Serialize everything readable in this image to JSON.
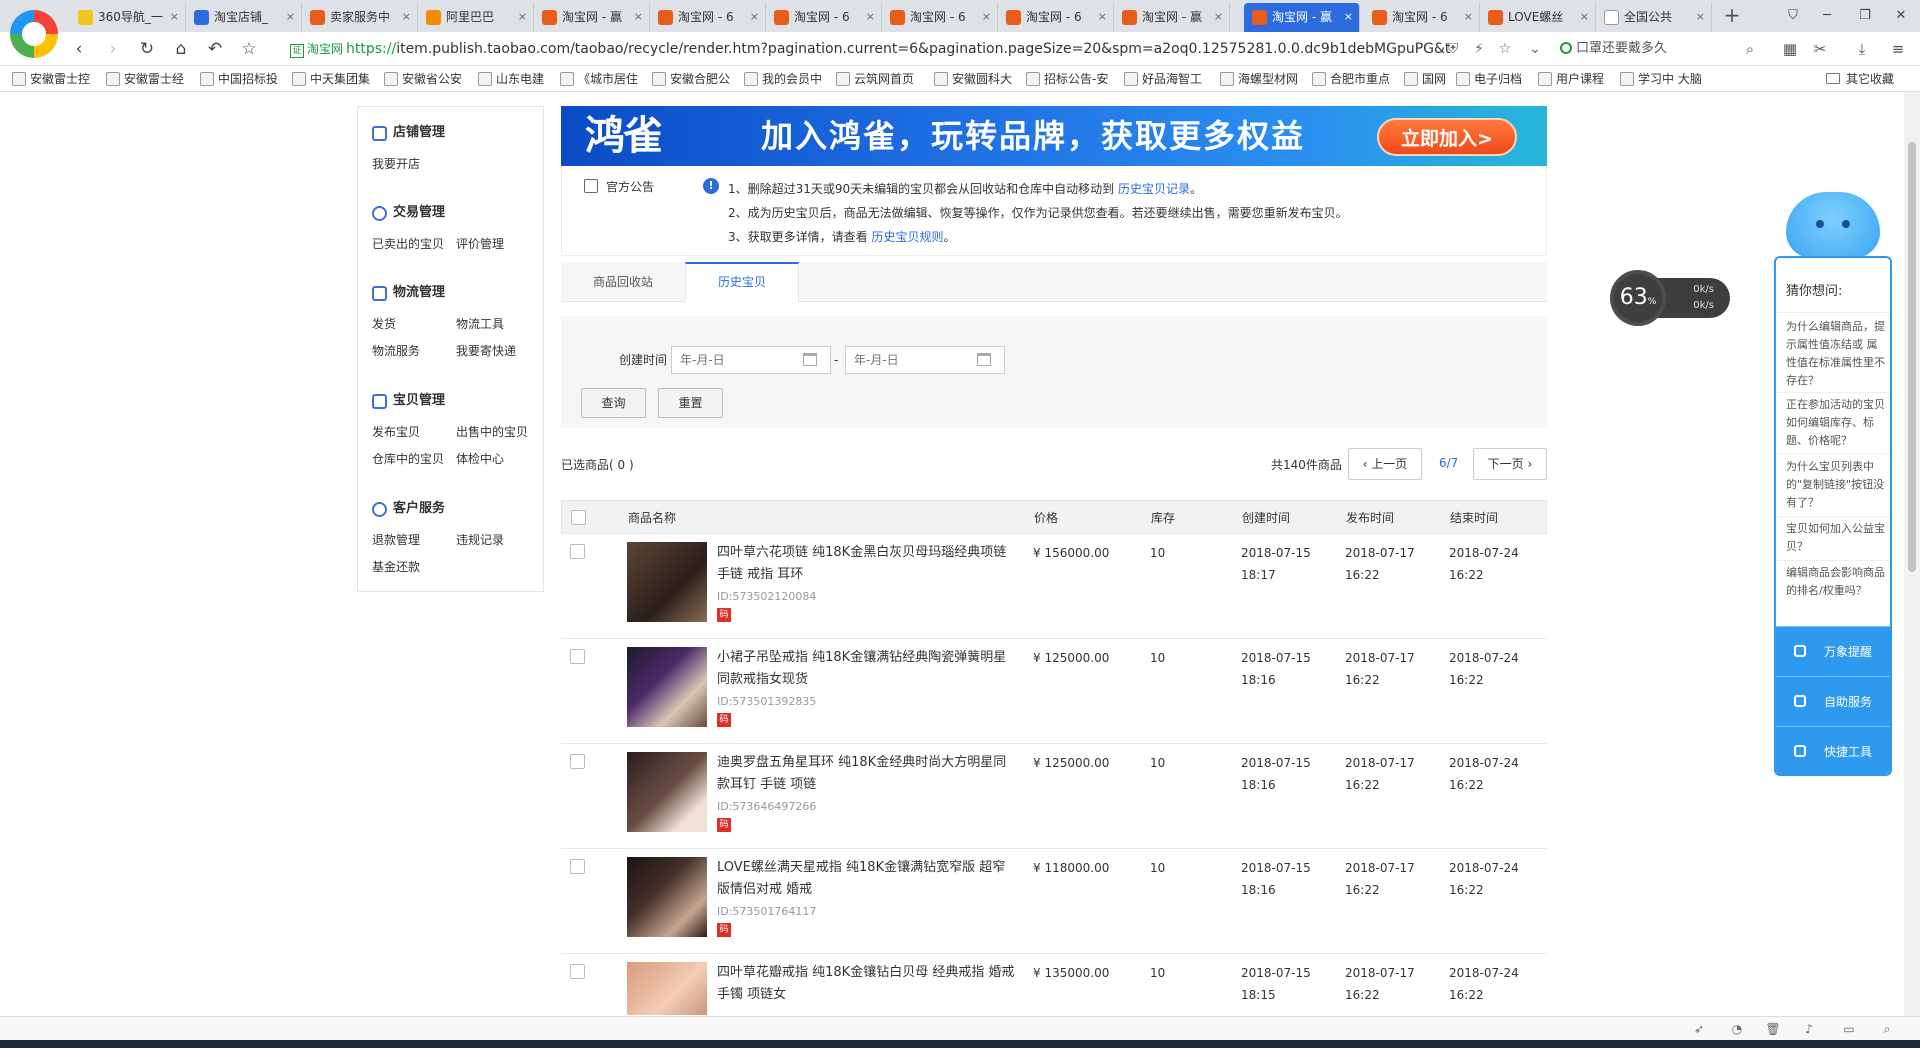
{
  "browser": {
    "tabs": [
      {
        "label": "360导航_一"
      },
      {
        "label": "淘宝店铺_"
      },
      {
        "label": "卖家服务中"
      },
      {
        "label": "阿里巴巴"
      },
      {
        "label": "淘宝网 - 赢"
      },
      {
        "label": "淘宝网 - 6"
      },
      {
        "label": "淘宝网 - 6"
      },
      {
        "label": "淘宝网 - 6"
      },
      {
        "label": "淘宝网 - 6"
      },
      {
        "label": "淘宝网 - 赢"
      },
      {
        "label": "淘宝网 - 赢"
      },
      {
        "label": "淘宝网 - 6"
      },
      {
        "label": "LOVE螺丝"
      },
      {
        "label": "全国公共"
      }
    ],
    "secure_label": "淘宝网",
    "url_prefix": "https://",
    "url_rest": "item.publish.taobao.com/taobao/recycle/render.htm?pagination.current=6&pagination.pageSize=20&spm=a2oq0.12575281.0.0.dc9b1debMGpuPG&t",
    "search_text": "口罩还要戴多久",
    "bookmarks": [
      "安徽雷士控",
      "安徽雷士经",
      "中国招标投",
      "中天集团集",
      "安徽省公安",
      "山东电建",
      "《城市居住",
      "安徽合肥公",
      "我的会员中",
      "云筑网首页",
      "安徽圆科大",
      "招标公告-安",
      "好品海智工",
      "海螺型材网",
      "合肥市重点",
      "国网",
      "电子归档",
      "用户课程",
      "学习中 大脑"
    ],
    "bookmarks_other": "其它收藏"
  },
  "sidebar": {
    "groups": [
      {
        "title": "店铺管理",
        "links": [
          "我要开店"
        ]
      },
      {
        "title": "交易管理",
        "links": [
          "已卖出的宝贝",
          "评价管理"
        ]
      },
      {
        "title": "物流管理",
        "links": [
          "发货",
          "物流工具",
          "物流服务",
          "我要寄快递"
        ]
      },
      {
        "title": "宝贝管理",
        "links": [
          "发布宝贝",
          "出售中的宝贝",
          "仓库中的宝贝",
          "体检中心"
        ]
      },
      {
        "title": "客户服务",
        "links": [
          "退款管理",
          "违规记录",
          "基金还款"
        ]
      }
    ]
  },
  "banner": {
    "logo": "鸿雀",
    "slogan": "加入鸿雀，玩转品牌，获取更多权益",
    "join": "立即加入>"
  },
  "notice": {
    "title": "官方公告",
    "line1_pre": "1、删除超过31天或90天未编辑的宝贝都会从回收站和仓库中自动移动到",
    "line1_link": "历史宝贝记录",
    "line1_post": "。",
    "line2": "2、成为历史宝贝后，商品无法做编辑、恢复等操作，仅作为记录供您查看。若还要继续出售，需要您重新发布宝贝。",
    "line3_pre": "3、获取更多详情，请查看",
    "line3_link": "历史宝贝规则",
    "line3_post": "。"
  },
  "tabs": [
    {
      "label": "商品回收站"
    },
    {
      "label": "历史宝贝"
    }
  ],
  "filter": {
    "label": "创建时间",
    "start_placeholder": "年-月-日",
    "end_placeholder": "年-月-日",
    "query": "查询",
    "reset": "重置"
  },
  "selection": {
    "selected": "已选商品( 0 )",
    "total": "共140件商品",
    "prev": "上一页",
    "page_info": "6/7",
    "next": "下一页"
  },
  "table": {
    "headers": [
      "商品名称",
      "价格",
      "库存",
      "创建时间",
      "发布时间",
      "结束时间"
    ],
    "rows": [
      {
        "name": "四叶草六花项链 纯18K金黑白灰贝母玛瑙经典项链 手链 戒指 耳环",
        "id": "ID:573502120084",
        "price": "¥ 156000.00",
        "stock": "10",
        "created": "2018-07-15 18:17",
        "published": "2018-07-17 16:22",
        "ended": "2018-07-24 16:22"
      },
      {
        "name": "小裙子吊坠戒指 纯18K金镶满钻经典陶瓷弹簧明星同款戒指女现货",
        "id": "ID:573501392835",
        "price": "¥ 125000.00",
        "stock": "10",
        "created": "2018-07-15 18:16",
        "published": "2018-07-17 16:22",
        "ended": "2018-07-24 16:22"
      },
      {
        "name": "迪奥罗盘五角星耳环 纯18K金经典时尚大方明星同款耳钉 手链 项链",
        "id": "ID:573646497266",
        "price": "¥ 125000.00",
        "stock": "10",
        "created": "2018-07-15 18:16",
        "published": "2018-07-17 16:22",
        "ended": "2018-07-24 16:22"
      },
      {
        "name": "LOVE螺丝满天星戒指 纯18K金镶满钻宽窄版 超窄版情侣对戒 婚戒",
        "id": "ID:573501764117",
        "price": "¥ 118000.00",
        "stock": "10",
        "created": "2018-07-15 18:16",
        "published": "2018-07-17 16:22",
        "ended": "2018-07-24 16:22"
      },
      {
        "name": "四叶草花瓣戒指 纯18K金镶钻白贝母 经典戒指 婚戒 手镯 项链女",
        "id": "",
        "price": "¥ 135000.00",
        "stock": "10",
        "created": "2018-07-15 18:15",
        "published": "2018-07-17 16:22",
        "ended": "2018-07-24 16:22"
      }
    ],
    "tag": "码"
  },
  "speed": {
    "percent": "63",
    "unit": "%",
    "up": "0k/s",
    "down": "0k/s"
  },
  "assistant": {
    "title": "猜你想问:",
    "questions": [
      "为什么编辑商品，提示属性值冻结或 属性值在标准属性里不存在？",
      "正在参加活动的宝贝如何编辑库存、标题、价格呢？",
      "为什么宝贝列表中的\"复制链接\"按钮没有了？",
      "宝贝如何加入公益宝贝？",
      "编辑商品会影响商品的排名/权重吗？"
    ],
    "buttons": [
      "万象提醒",
      "自助服务",
      "快捷工具"
    ]
  }
}
